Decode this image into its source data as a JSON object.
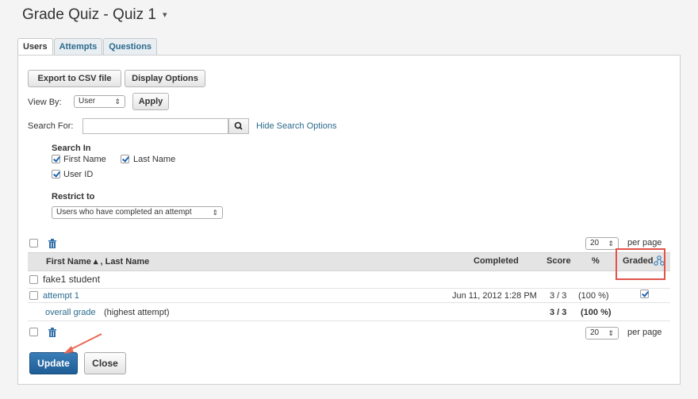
{
  "page": {
    "title": "Grade Quiz - Quiz 1",
    "caret": "▾"
  },
  "tabs": [
    {
      "label": "Users",
      "active": true
    },
    {
      "label": "Attempts",
      "active": false
    },
    {
      "label": "Questions",
      "active": false
    }
  ],
  "toolbar": {
    "export_label": "Export to CSV file",
    "display_options_label": "Display Options"
  },
  "view_by": {
    "label": "View By:",
    "value": "User",
    "apply_label": "Apply"
  },
  "search": {
    "label": "Search For:",
    "value": "",
    "hide_link": "Hide Search Options"
  },
  "search_in": {
    "heading": "Search In",
    "options": [
      {
        "label": "First Name",
        "checked": true
      },
      {
        "label": "Last Name",
        "checked": true
      },
      {
        "label": "User ID",
        "checked": true
      }
    ]
  },
  "restrict": {
    "heading": "Restrict to",
    "value": "Users who have completed an attempt"
  },
  "paging": {
    "per_page_value": "20",
    "per_page_label": "per page"
  },
  "table": {
    "columns": {
      "name": "First Name ▴ , Last Name",
      "completed": "Completed",
      "score": "Score",
      "percent": "%",
      "graded": "Graded"
    },
    "user_row": {
      "name": "fake1 student"
    },
    "attempt_row": {
      "label": "attempt 1",
      "completed": "Jun 11, 2012 1:28 PM",
      "score": "3 / 3",
      "percent": "(100 %)",
      "graded": true
    },
    "overall_row": {
      "link": "overall grade",
      "note": "(highest attempt)",
      "score": "3 / 3",
      "percent": "(100 %)"
    }
  },
  "actions": {
    "update_label": "Update",
    "close_label": "Close"
  },
  "colors": {
    "link": "#2a6a8c",
    "primary": "#1f5d96",
    "highlight": "#e2534b"
  }
}
